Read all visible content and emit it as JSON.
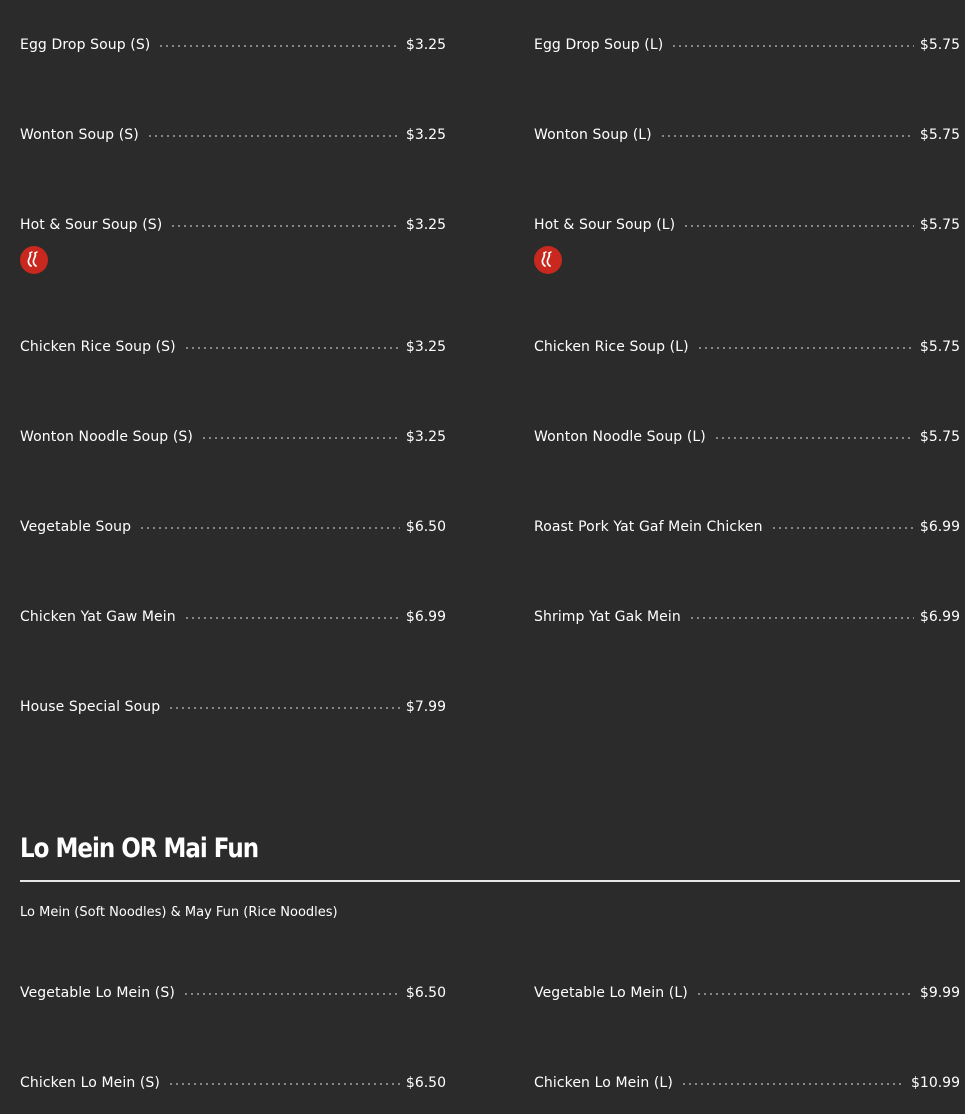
{
  "soups": {
    "left": [
      {
        "name": "Egg Drop Soup (S)",
        "price": "$3.25",
        "spicy": false
      },
      {
        "name": "Wonton Soup (S)",
        "price": "$3.25",
        "spicy": false
      },
      {
        "name": "Hot & Sour Soup (S)",
        "price": "$3.25",
        "spicy": true
      },
      {
        "name": "Chicken Rice Soup (S)",
        "price": "$3.25",
        "spicy": false
      },
      {
        "name": "Wonton Noodle Soup (S)",
        "price": "$3.25",
        "spicy": false
      },
      {
        "name": "Vegetable Soup",
        "price": "$6.50",
        "spicy": false
      },
      {
        "name": "Chicken Yat Gaw Mein",
        "price": "$6.99",
        "spicy": false
      },
      {
        "name": "House Special Soup",
        "price": "$7.99",
        "spicy": false
      }
    ],
    "right": [
      {
        "name": "Egg Drop Soup (L)",
        "price": "$5.75",
        "spicy": false
      },
      {
        "name": "Wonton Soup (L)",
        "price": "$5.75",
        "spicy": false
      },
      {
        "name": "Hot & Sour Soup (L)",
        "price": "$5.75",
        "spicy": true
      },
      {
        "name": "Chicken Rice Soup (L)",
        "price": "$5.75",
        "spicy": false
      },
      {
        "name": "Wonton Noodle Soup (L)",
        "price": "$5.75",
        "spicy": false
      },
      {
        "name": "Roast Pork Yat Gaf Mein Chicken",
        "price": "$6.99",
        "spicy": false
      },
      {
        "name": "Shrimp Yat Gak Mein",
        "price": "$6.99",
        "spicy": false
      }
    ]
  },
  "lo_mein": {
    "title": "Lo Mein OR Mai Fun",
    "description": "Lo Mein (Soft Noodles) & May Fun (Rice Noodles)",
    "left": [
      {
        "name": "Vegetable Lo Mein (S)",
        "price": "$6.50"
      },
      {
        "name": "Chicken Lo Mein (S)",
        "price": "$6.50"
      }
    ],
    "right": [
      {
        "name": "Vegetable Lo Mein (L)",
        "price": "$9.99"
      },
      {
        "name": "Chicken Lo Mein (L)",
        "price": "$10.99"
      }
    ]
  },
  "icons": {
    "spicy": "chili-pepper-icon"
  },
  "colors": {
    "background": "#2b2b2b",
    "text": "#ffffff",
    "spicy_badge": "#c8281e"
  }
}
